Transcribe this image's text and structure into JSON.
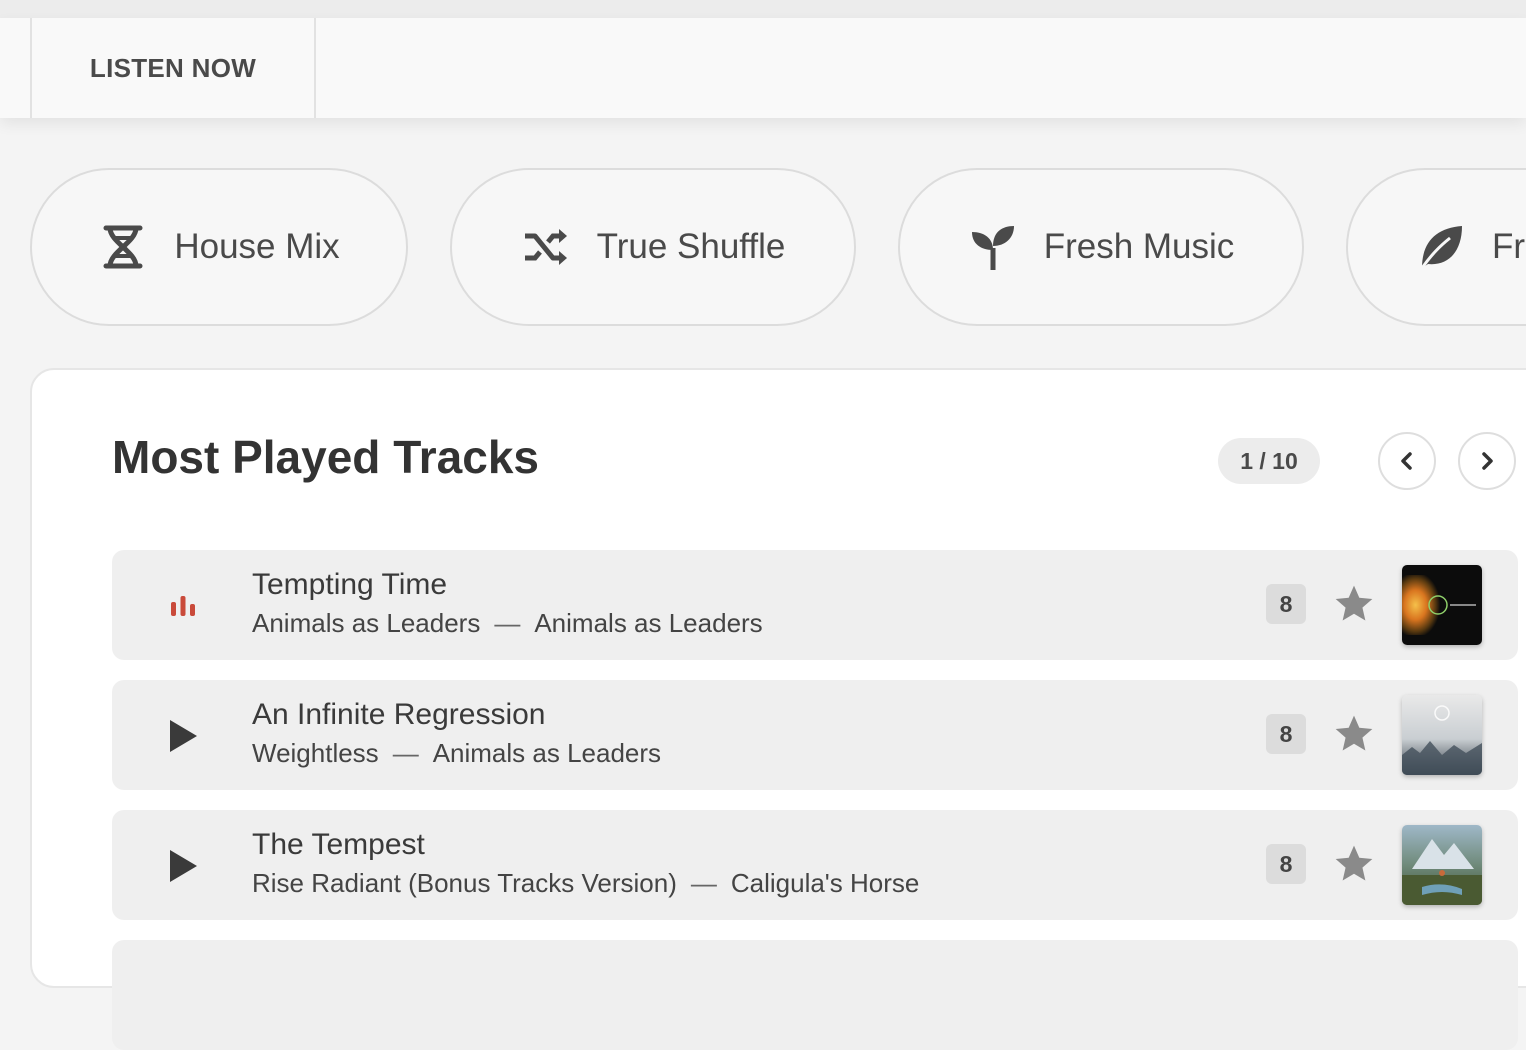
{
  "tabbar": {
    "active_tab": "LISTEN NOW"
  },
  "quick_mixes": [
    {
      "label": "House Mix",
      "icon": "dna-icon"
    },
    {
      "label": "True Shuffle",
      "icon": "shuffle-icon"
    },
    {
      "label": "Fresh Music",
      "icon": "sprout-icon"
    },
    {
      "label": "Fr",
      "icon": "leaf-icon"
    }
  ],
  "most_played": {
    "title": "Most Played Tracks",
    "pager": "1 / 10",
    "prev_icon": "chevron-left-icon",
    "next_icon": "chevron-right-icon",
    "tracks": [
      {
        "title": "Tempting Time",
        "album": "Animals as Leaders",
        "separator": "—",
        "artist": "Animals as Leaders",
        "play_count": "8",
        "state": "playing"
      },
      {
        "title": "An Infinite Regression",
        "album": "Weightless",
        "separator": "—",
        "artist": "Animals as Leaders",
        "play_count": "8",
        "state": "paused"
      },
      {
        "title": "The Tempest",
        "album": "Rise Radiant (Bonus Tracks Version)",
        "separator": "—",
        "artist": "Caligula's Horse",
        "play_count": "8",
        "state": "paused"
      }
    ]
  },
  "colors": {
    "playing_indicator": "#c94a3a",
    "icon_gray": "#4a4a4a",
    "star_gray": "#8a8a8a"
  }
}
